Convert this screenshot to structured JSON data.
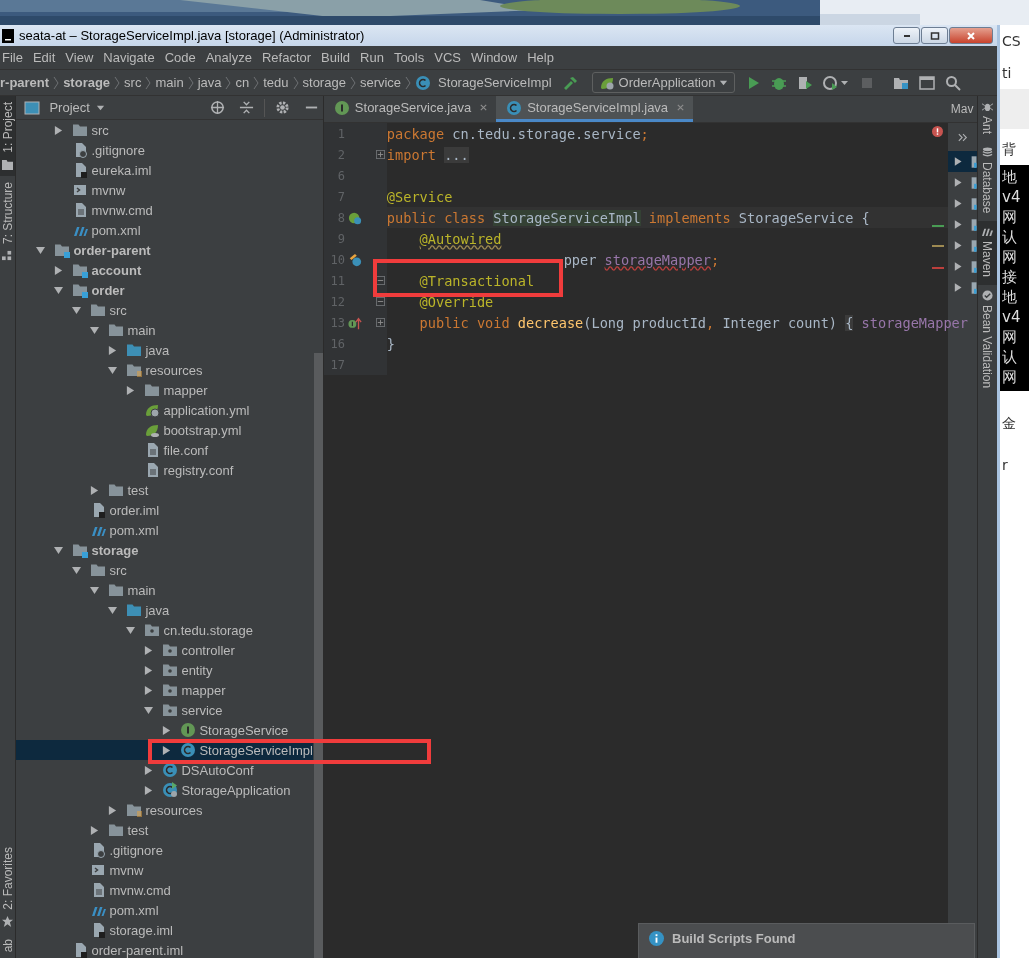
{
  "title_bar": {
    "title": "seata-at – StorageServiceImpl.java [storage] (Administrator)"
  },
  "menu": [
    "File",
    "Edit",
    "View",
    "Navigate",
    "Code",
    "Analyze",
    "Refactor",
    "Build",
    "Run",
    "Tools",
    "VCS",
    "Window",
    "Help"
  ],
  "breadcrumbs": [
    {
      "label": "r-parent",
      "kind": "module"
    },
    {
      "label": "storage",
      "kind": "module"
    },
    {
      "label": "src",
      "kind": "folder"
    },
    {
      "label": "main",
      "kind": "folder"
    },
    {
      "label": "java",
      "kind": "folder"
    },
    {
      "label": "cn",
      "kind": "folder"
    },
    {
      "label": "tedu",
      "kind": "folder"
    },
    {
      "label": "storage",
      "kind": "folder"
    },
    {
      "label": "service",
      "kind": "folder"
    },
    {
      "label": "StorageServiceImpl",
      "kind": "class"
    }
  ],
  "toolbar": {
    "run_config": "OrderApplication",
    "stop_disabled": true
  },
  "left_stripe": [
    {
      "label": "1: Project",
      "kind": "project",
      "selected": true
    },
    {
      "label": "7: Structure",
      "kind": "structure",
      "selected": false
    },
    {
      "label": "2: Favorites",
      "kind": "favorites",
      "selected": false
    },
    {
      "label": "ab",
      "kind": "plain",
      "selected": false
    }
  ],
  "project_panel": {
    "title": "Project",
    "tree_partial": [
      {
        "label": "src",
        "kind": "folder",
        "expanded": false,
        "selected": false
      },
      {
        "label": ".gitignore",
        "kind": "git",
        "selected": false
      },
      {
        "label": "eureka.iml",
        "kind": "iml",
        "selected": false
      },
      {
        "label": "mvnw",
        "kind": "mvnw",
        "selected": false
      },
      {
        "label": "mvnw.cmd",
        "kind": "text",
        "selected": false
      },
      {
        "label": "pom.xml",
        "kind": "maven",
        "selected": false
      }
    ],
    "tree": [
      {
        "label": "order-parent",
        "kind": "module",
        "expanded": true,
        "selected": false,
        "children": [
          {
            "label": "account",
            "kind": "module",
            "expanded": false,
            "selected": false
          },
          {
            "label": "order",
            "kind": "module",
            "expanded": true,
            "selected": false,
            "children": [
              {
                "label": "src",
                "kind": "folder",
                "expanded": true,
                "selected": false,
                "children": [
                  {
                    "label": "main",
                    "kind": "folder",
                    "expanded": true,
                    "selected": false,
                    "children": [
                      {
                        "label": "java",
                        "kind": "source",
                        "expanded": false,
                        "selected": false
                      },
                      {
                        "label": "resources",
                        "kind": "resources",
                        "expanded": true,
                        "selected": false,
                        "children": [
                          {
                            "label": "mapper",
                            "kind": "folder",
                            "expanded": false,
                            "selected": false
                          },
                          {
                            "label": "application.yml",
                            "kind": "spring-boot",
                            "selected": false
                          },
                          {
                            "label": "bootstrap.yml",
                            "kind": "spring",
                            "selected": false
                          },
                          {
                            "label": "file.conf",
                            "kind": "text",
                            "selected": false
                          },
                          {
                            "label": "registry.conf",
                            "kind": "text",
                            "selected": false
                          }
                        ]
                      }
                    ]
                  },
                  {
                    "label": "test",
                    "kind": "folder",
                    "expanded": false,
                    "selected": false
                  }
                ]
              },
              {
                "label": "order.iml",
                "kind": "iml",
                "selected": false
              },
              {
                "label": "pom.xml",
                "kind": "maven",
                "selected": false
              }
            ]
          },
          {
            "label": "storage",
            "kind": "module",
            "expanded": true,
            "selected": false,
            "children": [
              {
                "label": "src",
                "kind": "folder",
                "expanded": true,
                "selected": false,
                "children": [
                  {
                    "label": "main",
                    "kind": "folder",
                    "expanded": true,
                    "selected": false,
                    "children": [
                      {
                        "label": "java",
                        "kind": "source",
                        "expanded": true,
                        "selected": false,
                        "children": [
                          {
                            "label": "cn.tedu.storage",
                            "kind": "package",
                            "expanded": true,
                            "selected": false,
                            "children": [
                              {
                                "label": "controller",
                                "kind": "package",
                                "expanded": false,
                                "selected": false
                              },
                              {
                                "label": "entity",
                                "kind": "package",
                                "expanded": false,
                                "selected": false
                              },
                              {
                                "label": "mapper",
                                "kind": "package",
                                "expanded": false,
                                "selected": false
                              },
                              {
                                "label": "service",
                                "kind": "package",
                                "expanded": true,
                                "selected": false,
                                "children": [
                                  {
                                    "label": "StorageService",
                                    "kind": "interface",
                                    "expanded": false,
                                    "selected": false
                                  },
                                  {
                                    "label": "StorageServiceImpl",
                                    "kind": "class",
                                    "expanded": false,
                                    "selected": true
                                  }
                                ]
                              },
                              {
                                "label": "DSAutoConf",
                                "kind": "class",
                                "expanded": false,
                                "selected": false
                              },
                              {
                                "label": "StorageApplication",
                                "kind": "app",
                                "expanded": false,
                                "selected": false
                              }
                            ]
                          }
                        ]
                      },
                      {
                        "label": "resources",
                        "kind": "resources",
                        "expanded": false,
                        "selected": false
                      }
                    ]
                  },
                  {
                    "label": "test",
                    "kind": "folder",
                    "expanded": false,
                    "selected": false
                  }
                ]
              },
              {
                "label": ".gitignore",
                "kind": "git",
                "selected": false
              },
              {
                "label": "mvnw",
                "kind": "mvnw",
                "selected": false
              },
              {
                "label": "mvnw.cmd",
                "kind": "text",
                "selected": false
              },
              {
                "label": "pom.xml",
                "kind": "maven",
                "selected": false
              },
              {
                "label": "storage.iml",
                "kind": "iml",
                "selected": false
              }
            ]
          },
          {
            "label": "order-parent.iml",
            "kind": "iml",
            "selected": false
          }
        ]
      }
    ]
  },
  "editor_tabs": [
    {
      "label": "StorageService.java",
      "kind": "interface",
      "selected": false
    },
    {
      "label": "StorageServiceImpl.java",
      "kind": "class",
      "selected": true
    }
  ],
  "code_lines": [
    {
      "number": "1",
      "current": false,
      "indented": false,
      "tokens": [
        {
          "text": "package",
          "kind": "keyword"
        },
        {
          "text": " cn.tedu.storage.service",
          "kind": "plain"
        },
        {
          "text": ";",
          "kind": "keyword"
        }
      ]
    },
    {
      "number": "2",
      "fold_marker": {
        "collapsed": true
      },
      "current": false,
      "indented": false,
      "tokens": [
        {
          "text": "import ",
          "kind": "keyword"
        },
        {
          "text": "...",
          "kind": "folded"
        }
      ]
    },
    {
      "number": "6",
      "current": false
    },
    {
      "number": "7",
      "current": false,
      "indented": false,
      "tokens": [
        {
          "text": "@Service",
          "kind": "annotation"
        }
      ]
    },
    {
      "number": "8",
      "gutter_icon": {
        "kind": "bean"
      },
      "current": true,
      "indented": false,
      "tokens": [
        {
          "text": "public class ",
          "kind": "keyword"
        },
        {
          "text": "StorageServiceImpl",
          "kind": "highlighted"
        },
        {
          "text": " implements ",
          "kind": "keyword"
        },
        {
          "text": "StorageService {",
          "kind": "plain"
        }
      ]
    },
    {
      "number": "9",
      "current": false,
      "indented": true,
      "tokens": [
        {
          "text": "@Autowired",
          "kind": "annotation-warning"
        }
      ]
    },
    {
      "number": "10",
      "gutter_icon": {
        "kind": "autowired"
      },
      "current": false,
      "indented": false,
      "tokens": [
        {
          "text": "pper ",
          "kind": "after-cover"
        },
        {
          "text": "storageMapper",
          "kind": "field-error"
        },
        {
          "text": ";",
          "kind": "keyword"
        }
      ]
    },
    {
      "number": "11",
      "fold_marker": {
        "collapsed": false
      },
      "current": false,
      "indented": true,
      "tokens": [
        {
          "text": "@Transactional",
          "kind": "annotation"
        }
      ]
    },
    {
      "number": "12",
      "fold_marker": {
        "collapsed": false
      },
      "current": false,
      "indented": true,
      "tokens": [
        {
          "text": "@Override",
          "kind": "annotation"
        }
      ]
    },
    {
      "number": "13",
      "gutter_icon": {
        "kind": "implements"
      },
      "fold_marker": {
        "collapsed": true
      },
      "current": false,
      "indented": true,
      "tokens": [
        {
          "text": "public void ",
          "kind": "keyword"
        },
        {
          "text": "decrease",
          "kind": "method"
        },
        {
          "text": "(Long productId",
          "kind": "plain"
        },
        {
          "text": ", ",
          "kind": "keyword"
        },
        {
          "text": "Integer count) ",
          "kind": "plain"
        },
        {
          "text": "{",
          "kind": "folded"
        },
        {
          "text": " storageMapper",
          "kind": "field"
        }
      ]
    },
    {
      "number": "16",
      "current": false,
      "indented": false,
      "tokens": [
        {
          "text": "}",
          "kind": "plain"
        }
      ]
    },
    {
      "number": "17",
      "current": false
    }
  ],
  "maven_panel": {
    "title": "Mav",
    "rows": [
      {
        "selected": true
      },
      {
        "selected": false
      },
      {
        "selected": false
      },
      {
        "selected": false
      },
      {
        "selected": false
      },
      {
        "selected": false
      },
      {
        "selected": false
      }
    ]
  },
  "right_stripe": [
    {
      "label": "Ant",
      "kind": "ant",
      "selected": false
    },
    {
      "label": "Database",
      "kind": "database",
      "selected": false
    },
    {
      "label": "Maven",
      "kind": "maven",
      "selected": true
    },
    {
      "label": "Bean Validation",
      "kind": "bean",
      "selected": false
    }
  ],
  "notification": {
    "title": "Build Scripts Found"
  },
  "background_window": {
    "header": [
      "CS",
      "ti"
    ],
    "tab": "背",
    "console": [
      "地",
      "v4",
      "网",
      "认",
      "网",
      "接",
      "地",
      "v4",
      "网",
      "认",
      "网"
    ],
    "footer": [
      "金",
      "r"
    ]
  }
}
